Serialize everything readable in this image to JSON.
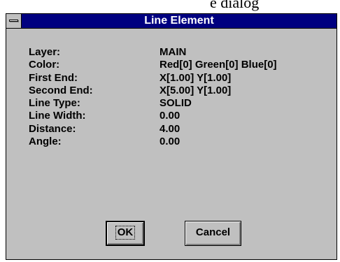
{
  "caption_fragment": "e dialog",
  "window": {
    "title": "Line Element"
  },
  "properties": [
    {
      "label": "Layer:",
      "value": "MAIN"
    },
    {
      "label": "Color:",
      "value": "Red[0] Green[0] Blue[0]"
    },
    {
      "label": "First End:",
      "value": "X[1.00] Y[1.00]"
    },
    {
      "label": "Second End:",
      "value": "X[5.00] Y[1.00]"
    },
    {
      "label": "Line Type:",
      "value": "SOLID"
    },
    {
      "label": "Line Width:",
      "value": "0.00"
    },
    {
      "label": "Distance:",
      "value": "4.00"
    },
    {
      "label": "Angle:",
      "value": "0.00"
    }
  ],
  "buttons": {
    "ok_label": "OK",
    "cancel_label": "Cancel"
  },
  "colors": {
    "titlebar": "#000080",
    "dialog_face": "#c0c0c0"
  }
}
